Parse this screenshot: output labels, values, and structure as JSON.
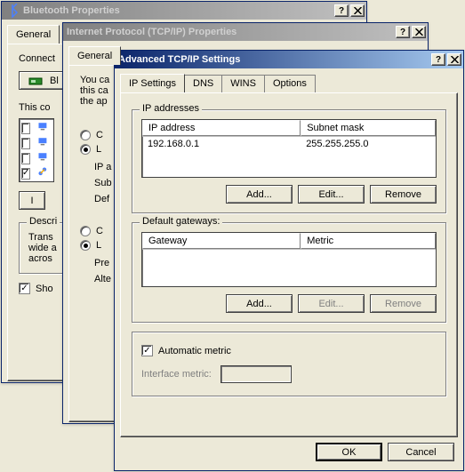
{
  "win1": {
    "title": "Bluetooth Properties",
    "tab_general": "General",
    "connect_label": "Connect",
    "sidebar_btn": "Bl",
    "this_co": "This co",
    "descri": "Descri",
    "trans": "Trans",
    "widea": "wide a",
    "acros": "acros",
    "show": "Sho"
  },
  "win2": {
    "title": "Internet Protocol (TCP/IP) Properties",
    "tab_general": "General",
    "you_ca": "You ca",
    "this_ca": "this ca",
    "the_ap": "the ap",
    "ipa": "IP a",
    "sub": "Sub",
    "def": "Def",
    "pre": "Pre",
    "alte": "Alte"
  },
  "win3": {
    "title": "Advanced TCP/IP Settings",
    "tabs": {
      "ip_settings": "IP Settings",
      "dns": "DNS",
      "wins": "WINS",
      "options": "Options"
    },
    "ip_group": "IP addresses",
    "ip_cols": {
      "addr": "IP address",
      "mask": "Subnet mask"
    },
    "ip_rows": [
      {
        "addr": "192.168.0.1",
        "mask": "255.255.255.0"
      }
    ],
    "gw_group": "Default gateways:",
    "gw_cols": {
      "gw": "Gateway",
      "metric": "Metric"
    },
    "gw_rows": [],
    "buttons": {
      "add": "Add...",
      "edit": "Edit...",
      "remove": "Remove"
    },
    "auto_metric": "Automatic metric",
    "auto_metric_checked": true,
    "iface_metric": "Interface metric:",
    "ok": "OK",
    "cancel": "Cancel"
  }
}
